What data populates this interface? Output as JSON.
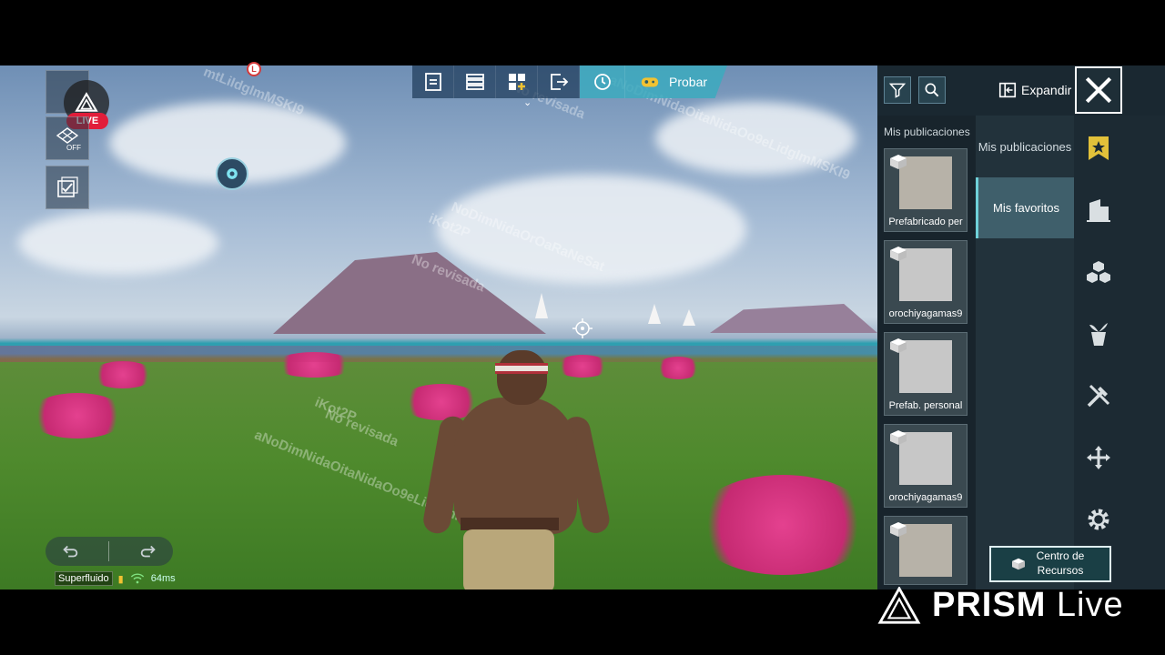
{
  "toolbar": {
    "buttons": [
      "save-icon",
      "layers-icon",
      "grid-add-icon",
      "exit-icon",
      "cycle-icon"
    ],
    "probar_label": "Probar"
  },
  "hud": {
    "live_badge": "LIVE",
    "grid_toggle": "OFF",
    "marker_letter": "L",
    "status_quality": "Superfluido",
    "status_ping": "64ms"
  },
  "watermarks": [
    "mtLiIdgImMSKI9",
    "No revisada",
    "aNoDimNidaOitaNidaOo9eLidgImMSKI9",
    "NoDimNidaOrOaRaNeSat",
    "iKot2P",
    "No revisada",
    "aNoDimNidaOitaNidaOo9eLidgImMSKI9",
    "iKot2P",
    "No revisada"
  ],
  "panel": {
    "expand_label": "Expandir",
    "section_label": "Mis publicaciones",
    "tabs": [
      {
        "label": "Mis publicaciones",
        "active": false
      },
      {
        "label": "Mis favoritos",
        "active": true
      }
    ],
    "cards": [
      {
        "label": "Prefabricado per"
      },
      {
        "label": "orochiyagamas9"
      },
      {
        "label": "Prefab. personal"
      },
      {
        "label": "orochiyagamas9"
      },
      {
        "label": ""
      }
    ],
    "side_icons": [
      "star-bookmark-icon",
      "building-icon",
      "cubes-icon",
      "plant-pot-icon",
      "tools-icon",
      "move-icon",
      "settings-gear-icon"
    ],
    "resource_button": "Centro de Recursos"
  },
  "branding": {
    "prism_bold": "PRISM",
    "prism_light": "Live"
  },
  "colors": {
    "accent_cyan": "#3caabe",
    "live_red": "#e11d3a",
    "panel_bg": "#1c2a33",
    "active_tab": "#3f5f6b"
  }
}
